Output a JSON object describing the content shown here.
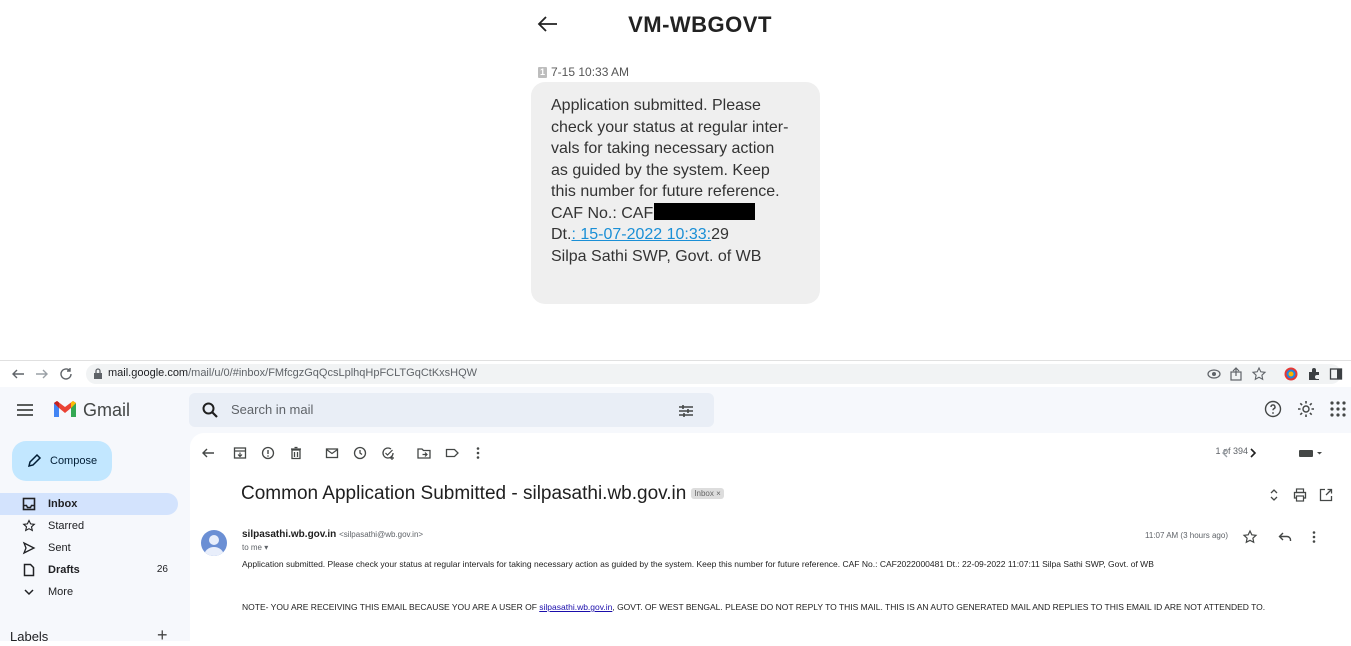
{
  "sms": {
    "title": "VM-WBGOVT",
    "sim_slot": "1",
    "timestamp": "7-15 10:33 AM",
    "lines": [
      "Application submitted. Please",
      "check your status at regular inter-",
      "vals for taking necessary action",
      "as guided by the system. Keep",
      "this number for future reference."
    ],
    "caf_label": "CAF No.: CAF",
    "date_prefix": "Dt.",
    "date_link": ": 15-07-2022 10:33:",
    "date_suffix": "29",
    "signature": "Silpa Sathi SWP, Govt. of WB",
    "link_color": "#1a8fd6"
  },
  "browser": {
    "url_host": "mail.google.com",
    "url_path": "/mail/u/0/#inbox/FMfcgzGqQcsLplhqHpFCLTGqCtKxsHQW"
  },
  "gmail": {
    "app_name": "Gmail",
    "search_placeholder": "Search in mail",
    "compose_label": "Compose",
    "nav": [
      {
        "label": "Inbox",
        "icon": "inbox-icon",
        "count": ""
      },
      {
        "label": "Starred",
        "icon": "star-icon",
        "count": ""
      },
      {
        "label": "Sent",
        "icon": "sent-icon",
        "count": ""
      },
      {
        "label": "Drafts",
        "icon": "draft-icon",
        "count": "26"
      },
      {
        "label": "More",
        "icon": "chevron-down-icon",
        "count": ""
      }
    ],
    "labels_header": "Labels",
    "labels_add": "+",
    "pager": "1 of 394",
    "subject": "Common Application Submitted - silpasathi.wb.gov.in",
    "inbox_chip": "Inbox ×",
    "sender_name": "silpasathi.wb.gov.in",
    "sender_addr": "<silpasathi@wb.gov.in>",
    "to": "to me ▾",
    "time": "11:07 AM (3 hours ago)",
    "body": "Application submitted. Please check your status at regular intervals for taking necessary action as guided by the system. Keep this number for future reference. CAF No.: CAF2022000481 Dt.: 22-09-2022 11:07:11 Silpa Sathi SWP, Govt. of WB",
    "note_before": "NOTE- YOU ARE RECEIVING THIS EMAIL BECAUSE YOU ARE A USER OF ",
    "note_link": "silpasathi.wb.gov.in",
    "note_after": ", GOVT. OF WEST BENGAL. PLEASE DO NOT REPLY TO THIS MAIL. THIS IS AN AUTO GENERATED MAIL AND REPLIES TO THIS EMAIL ID ARE NOT ATTENDED TO.",
    "accent_compose": "#c2e7ff",
    "accent_active": "#d3e3fd"
  }
}
